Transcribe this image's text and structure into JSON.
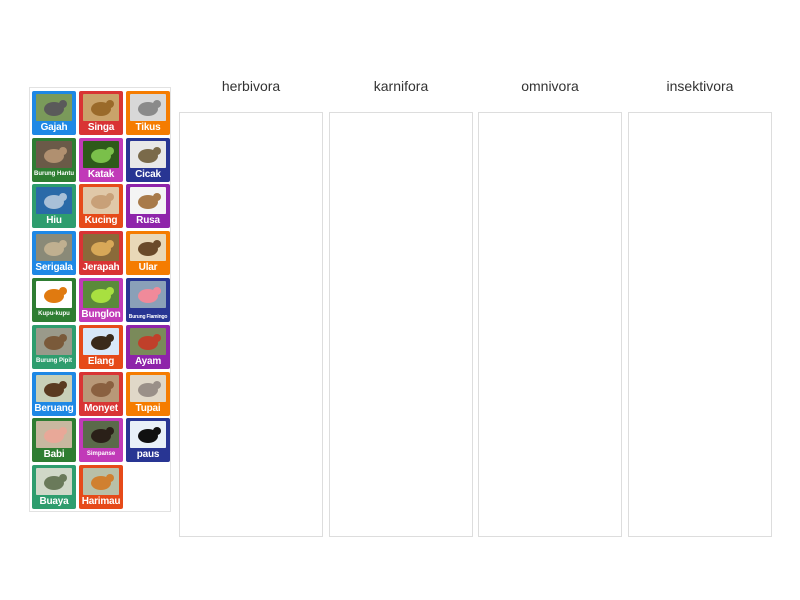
{
  "columns": [
    {
      "label": "herbivora"
    },
    {
      "label": "karnifora"
    },
    {
      "label": "omnivora"
    },
    {
      "label": "insektivora"
    }
  ],
  "cards": [
    {
      "label": "Gajah",
      "color": "#1e88e5",
      "icon": "elephant-icon",
      "size": "normal"
    },
    {
      "label": "Singa",
      "color": "#d93434",
      "icon": "lion-icon",
      "size": "normal"
    },
    {
      "label": "Tikus",
      "color": "#f57c00",
      "icon": "mouse-icon",
      "size": "normal"
    },
    {
      "label": "Burung Hantu",
      "color": "#2e7d32",
      "icon": "owl-icon",
      "size": "small"
    },
    {
      "label": "Katak",
      "color": "#c13ab8",
      "icon": "frog-icon",
      "size": "normal"
    },
    {
      "label": "Cicak",
      "color": "#283593",
      "icon": "gecko-icon",
      "size": "normal"
    },
    {
      "label": "Hiu",
      "color": "#2e9d6e",
      "icon": "shark-icon",
      "size": "normal"
    },
    {
      "label": "Kucing",
      "color": "#e64a19",
      "icon": "cat-icon",
      "size": "normal"
    },
    {
      "label": "Rusa",
      "color": "#8e24aa",
      "icon": "deer-icon",
      "size": "normal"
    },
    {
      "label": "Serigala",
      "color": "#1e88e5",
      "icon": "wolf-icon",
      "size": "normal"
    },
    {
      "label": "Jerapah",
      "color": "#d93434",
      "icon": "giraffe-icon",
      "size": "normal"
    },
    {
      "label": "Ular",
      "color": "#f57c00",
      "icon": "snake-icon",
      "size": "normal"
    },
    {
      "label": "Kupu-kupu",
      "color": "#2e7d32",
      "icon": "butterfly-icon",
      "size": "small"
    },
    {
      "label": "Bunglon",
      "color": "#c13ab8",
      "icon": "chameleon-icon",
      "size": "normal"
    },
    {
      "label": "Burung Flamingo",
      "color": "#283593",
      "icon": "flamingo-icon",
      "size": "tiny"
    },
    {
      "label": "Burung Pipit",
      "color": "#2e9d6e",
      "icon": "sparrow-icon",
      "size": "small"
    },
    {
      "label": "Elang",
      "color": "#e64a19",
      "icon": "eagle-icon",
      "size": "normal"
    },
    {
      "label": "Ayam",
      "color": "#8e24aa",
      "icon": "rooster-icon",
      "size": "normal"
    },
    {
      "label": "Beruang",
      "color": "#1e88e5",
      "icon": "bear-icon",
      "size": "normal"
    },
    {
      "label": "Monyet",
      "color": "#d93434",
      "icon": "monkey-icon",
      "size": "normal"
    },
    {
      "label": "Tupai",
      "color": "#f57c00",
      "icon": "squirrel-icon",
      "size": "normal"
    },
    {
      "label": "Babi",
      "color": "#2e7d32",
      "icon": "pig-icon",
      "size": "normal"
    },
    {
      "label": "Simpanse",
      "color": "#c13ab8",
      "icon": "chimpanzee-icon",
      "size": "small"
    },
    {
      "label": "paus",
      "color": "#283593",
      "icon": "orca-icon",
      "size": "normal"
    },
    {
      "label": "Buaya",
      "color": "#2e9d6e",
      "icon": "crocodile-icon",
      "size": "normal"
    },
    {
      "label": "Harimau",
      "color": "#e64a19",
      "icon": "tiger-icon",
      "size": "normal"
    }
  ]
}
